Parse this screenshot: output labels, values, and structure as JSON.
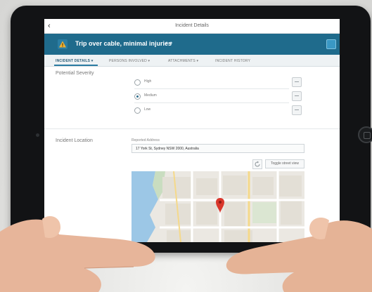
{
  "screen": {
    "title": "Incident Details",
    "back_icon": "‹"
  },
  "header": {
    "incident_title": "Trip over cable, minimal injuries",
    "dots": "● ●",
    "warning_icon": "warning-triangle-icon"
  },
  "tabs": [
    {
      "label": "INCIDENT DETAILS ▾",
      "active": true
    },
    {
      "label": "PERSONS INVOLVED ▾",
      "active": false
    },
    {
      "label": "ATTACHMENTS ▾",
      "active": false
    },
    {
      "label": "INCIDENT HISTORY",
      "active": false
    }
  ],
  "severity": {
    "label": "Potential Severity",
    "options": [
      {
        "label": "High",
        "checked": false
      },
      {
        "label": "Medium",
        "checked": true
      },
      {
        "label": "Low",
        "checked": false
      }
    ]
  },
  "location": {
    "label": "Incident Location",
    "field_label": "Reported Address",
    "address": "17 York St, Sydney NSW 2000, Australia",
    "toggle_label": "Toggle street view"
  },
  "colors": {
    "header_band": "#1f6b8c",
    "tab_active": "#2b7ba2",
    "map_pin": "#d9362b",
    "water": "#9cc7e6"
  }
}
